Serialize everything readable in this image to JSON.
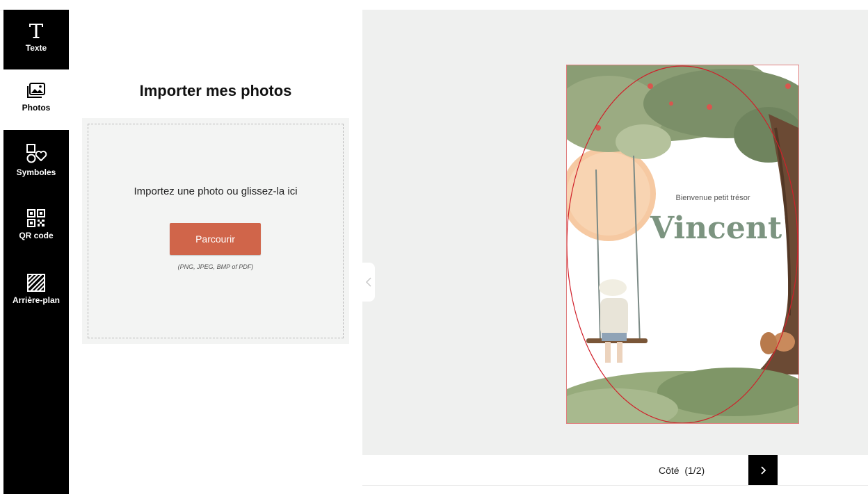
{
  "sidebar": {
    "items": [
      {
        "label": "Texte",
        "icon": "text-icon"
      },
      {
        "label": "Photos",
        "icon": "photos-icon"
      },
      {
        "label": "Symboles",
        "icon": "symbols-icon"
      },
      {
        "label": "QR code",
        "icon": "qr-code-icon"
      },
      {
        "label": "Arrière-plan",
        "icon": "background-pattern-icon"
      }
    ],
    "active": "Photos"
  },
  "panel": {
    "title": "Importer mes photos",
    "upload_text": "Importez une photo ou glissez-la ici",
    "browse_label": "Parcourir",
    "formats": "(PNG, JPEG, BMP of PDF)"
  },
  "card": {
    "subtitle": "Bienvenue petit trésor",
    "name": "Vincent",
    "name_color": "#7c9480"
  },
  "pagination": {
    "label": "Côté  (1/2)",
    "next_icon": "chevron-right-icon"
  },
  "colors": {
    "accent": "#d0654a",
    "rail": "#000000",
    "canvas": "#eff0ef"
  }
}
